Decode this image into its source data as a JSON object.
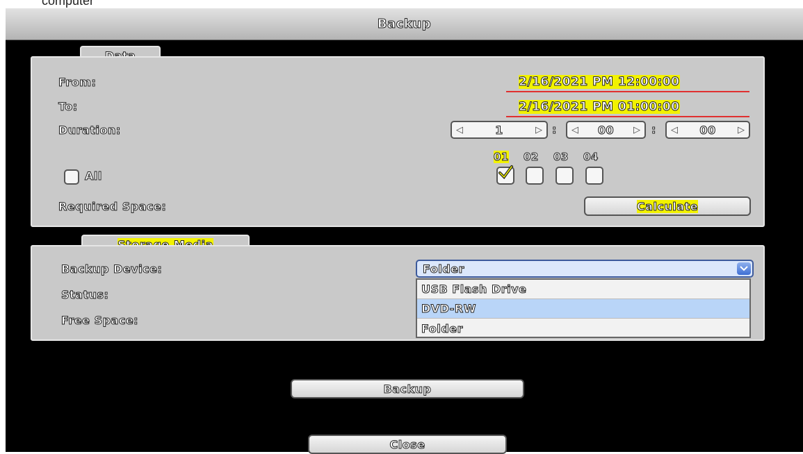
{
  "top_caption": "computer",
  "window": {
    "title": "Backup"
  },
  "data_panel": {
    "tab": "Data",
    "from_label": "From:",
    "to_label": "To:",
    "from_value": "2/16/2021 PM 12:00:00",
    "to_value": "2/16/2021 PM 01:00:00",
    "duration_label": "Duration:",
    "duration": {
      "hours": "1",
      "minutes": "00",
      "seconds": "00",
      "separator": ":"
    },
    "all_label": "All",
    "channels": [
      {
        "label": "01",
        "checked": true
      },
      {
        "label": "02",
        "checked": false
      },
      {
        "label": "03",
        "checked": false
      },
      {
        "label": "04",
        "checked": false
      }
    ],
    "required_space_label": "Required Space:",
    "calculate_button": "Calculate"
  },
  "storage_panel": {
    "tab": "Storage Media",
    "backup_device_label": "Backup Device:",
    "status_label": "Status:",
    "free_space_label": "Free Space:",
    "device_selected": "Folder",
    "device_options": [
      "USB Flash Drive",
      "DVD-RW",
      "Folder"
    ],
    "highlighted_option": "DVD-RW"
  },
  "buttons": {
    "backup": "Backup",
    "close": "Close"
  },
  "colors": {
    "highlight": "#f2f200",
    "underline": "#e03030",
    "accent": "#3f6fd4"
  }
}
